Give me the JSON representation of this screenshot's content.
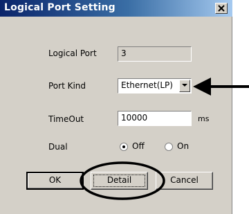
{
  "window": {
    "title": "Logical Port Setting",
    "close_glyph": "×"
  },
  "form": {
    "logical_port": {
      "label": "Logical Port",
      "value": "3"
    },
    "port_kind": {
      "label": "Port Kind",
      "selected": "Ethernet(LP)"
    },
    "timeout": {
      "label": "TimeOut",
      "value": "10000",
      "unit": "ms"
    },
    "dual": {
      "label": "Dual",
      "options": [
        {
          "label": "Off",
          "checked": true
        },
        {
          "label": "On",
          "checked": false
        }
      ]
    }
  },
  "buttons": {
    "ok": "OK",
    "detail": "Detail",
    "cancel": "Cancel"
  },
  "annotations": {
    "arrow_color": "#000000",
    "highlight_color": "#000000"
  }
}
